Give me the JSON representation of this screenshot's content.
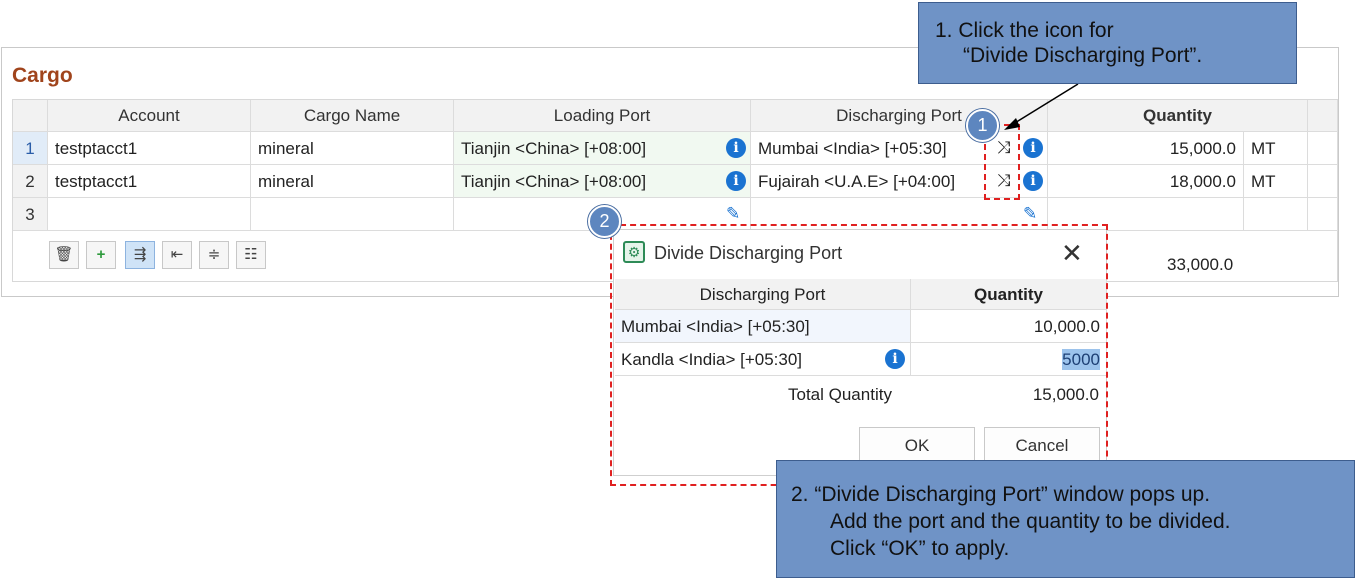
{
  "panel": {
    "title": "Cargo",
    "columns": [
      "Account",
      "Cargo Name",
      "Loading Port",
      "Discharging Port",
      "Quantity"
    ],
    "rows": [
      {
        "num": "1",
        "account": "testptacct1",
        "cargo": "mineral",
        "loading": "Tianjin <China> [+08:00]",
        "discharging": "Mumbai <India> [+05:30]",
        "quantity": "15,000.0",
        "unit": "MT"
      },
      {
        "num": "2",
        "account": "testptacct1",
        "cargo": "mineral",
        "loading": "Tianjin <China> [+08:00]",
        "discharging": "Fujairah <U.A.E> [+04:00]",
        "quantity": "18,000.0",
        "unit": "MT"
      },
      {
        "num": "3",
        "account": "",
        "cargo": "",
        "loading": "",
        "discharging": "",
        "quantity": "",
        "unit": ""
      }
    ],
    "total_quantity": "33,000.0",
    "toolbar": [
      {
        "icon": "delete-icon",
        "glyph": "🗑"
      },
      {
        "icon": "add-icon",
        "glyph": "+"
      },
      {
        "icon": "divide-loading-icon",
        "glyph": "⇶"
      },
      {
        "icon": "insert-row-icon",
        "glyph": "⇤"
      },
      {
        "icon": "split-row-icon",
        "glyph": "≑"
      },
      {
        "icon": "merge-rows-icon",
        "glyph": "☷"
      }
    ]
  },
  "dialog": {
    "title": "Divide Discharging Port",
    "columns": [
      "Discharging Port",
      "Quantity"
    ],
    "rows": [
      {
        "port": "Mumbai <India> [+05:30]",
        "quantity": "10,000.0"
      },
      {
        "port": "Kandla <India> [+05:30]",
        "quantity": "5000"
      }
    ],
    "total_label": "Total Quantity",
    "total_value": "15,000.0",
    "ok_label": "OK",
    "cancel_label": "Cancel",
    "close_glyph": "✕"
  },
  "annotations": {
    "callout1": {
      "line1": "1.  Click the icon for",
      "line2": "“Divide Discharging Port”."
    },
    "callout2": {
      "line1": "2. “Divide Discharging Port” window pops up.",
      "line2": "Add the port and the quantity to be divided.",
      "line3": "Click “OK” to apply."
    },
    "badge1": "1",
    "badge2": "2"
  },
  "colors": {
    "accent_title": "#a0441c",
    "info_icon": "#1a73d1",
    "callout_fill": "#6f93c6",
    "dash_red": "#e02020"
  }
}
